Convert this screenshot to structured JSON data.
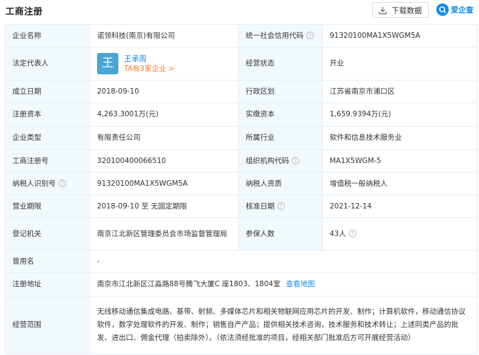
{
  "header": {
    "title": "工商注册",
    "download_label": "下载数据",
    "brand_name": "爱企查",
    "download_icon": "download-icon",
    "brand_icon": "aiqicha-logo"
  },
  "company": {
    "name_label": "企业名称",
    "name_value": "诺领科技(南京)有限公司",
    "credit_code_label": "统一社会信用代码",
    "credit_code_value": "91320100MA1X5WGM5A",
    "rep_label": "法定代表人",
    "rep_avatar": "王",
    "rep_name": "王承周",
    "rep_link": "TA有3家企业 >",
    "status_label": "经营状态",
    "status_value": "开业",
    "founded_label": "成立日期",
    "founded_value": "2018-09-10",
    "region_label": "行政区划",
    "region_value": "江苏省南京市浦口区",
    "capital_label": "注册资本",
    "capital_value": "4,263.3001万(元)",
    "paid_label": "实缴资本",
    "paid_value": "1,659.9394万(元)",
    "type_label": "企业类型",
    "type_value": "有限责任公司",
    "industry_label": "所属行业",
    "industry_value": "软件和信息技术服务业",
    "reg_no_label": "工商注册号",
    "reg_no_value": "320100400066510",
    "org_code_label": "组织机构代码",
    "org_code_value": "MA1X5WGM-5",
    "tax_id_label": "纳税人识别号",
    "tax_id_value": "91320100MA1X5WGM5A",
    "taxpayer_label": "纳税人资质",
    "taxpayer_value": "增值税一般纳税人",
    "term_label": "营业期限",
    "term_value": "2018-09-10 至 无固定期限",
    "approval_label": "核准日期",
    "approval_value": "2021-12-14",
    "authority_label": "登记机关",
    "authority_value": "南京江北新区管理委员会市场监督管理局",
    "insured_label": "参保人数",
    "insured_value": "43人",
    "former_label": "曾用名",
    "former_value": "-",
    "address_label": "注册地址",
    "address_value": "南京市江北新区江淼路88号腾飞大厦C 座1803、1804室",
    "map_link": "查看地图",
    "scope_label": "经营范围",
    "scope_value": "无线移动通信集成电路、基带、射频、多媒体芯片和相关物联网应用芯片的开发、制作；计算机软件，移动通信协议软件，数字处理软件的开发、制作；销售自产产品；提供相关技术咨询，技术服务和技术转让；上述同类产品的批发、进出口、佣金代理（拍卖除外）。（依法须经批准的项目，经相关部门批准后方可开展经营活动）"
  },
  "help_glyph": "?",
  "colors": {
    "accent": "#128bed",
    "orange": "#ff7a1a",
    "label_bg": "#f2f9fc",
    "border": "#e4eef6"
  }
}
